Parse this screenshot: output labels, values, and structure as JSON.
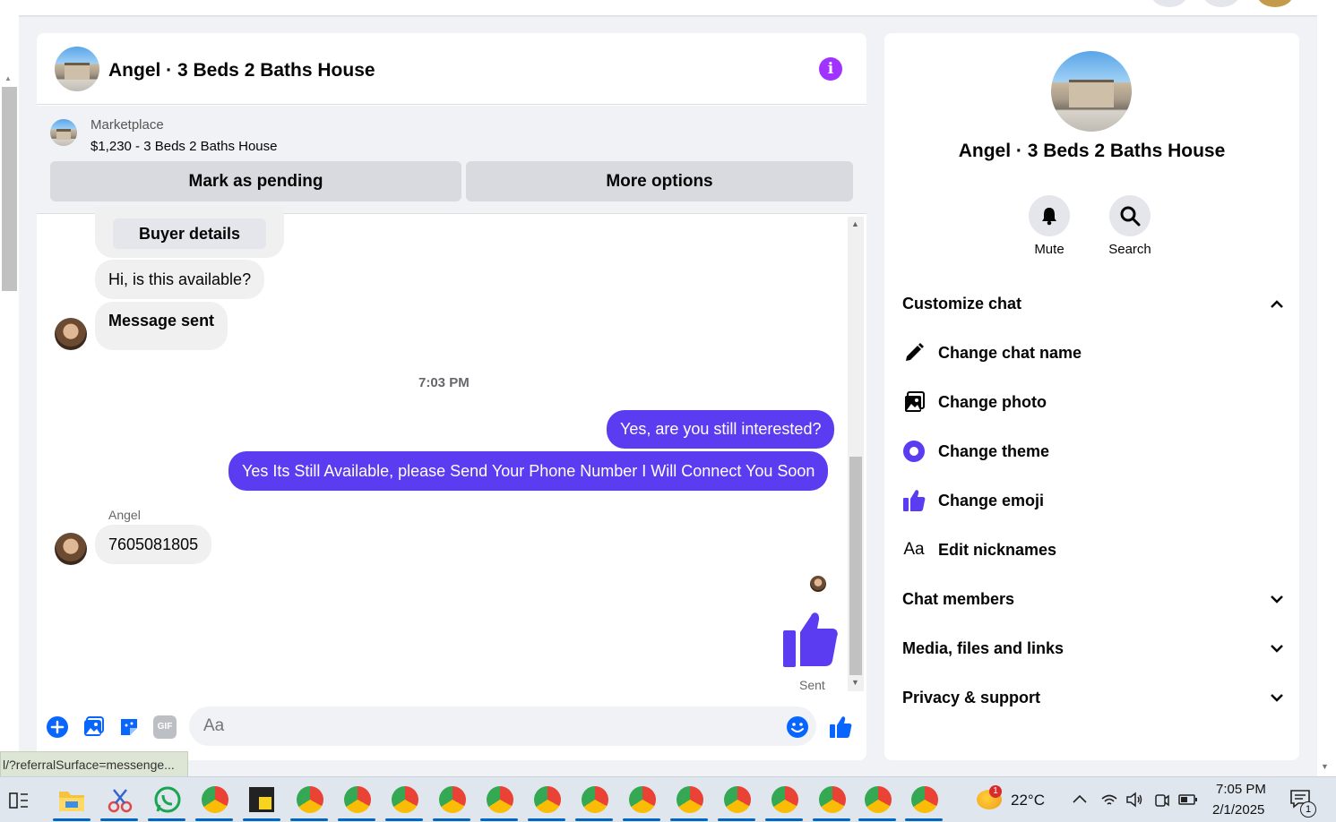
{
  "chat": {
    "title": "Angel · 3 Beds 2 Baths House",
    "marketplace_label": "Marketplace",
    "listing": "$1,230 - 3 Beds 2 Baths House",
    "mark_pending_label": "Mark as pending",
    "more_options_label": "More options"
  },
  "messages": {
    "buyer_details_label": "Buyer details",
    "incoming_1": "Hi, is this available?",
    "incoming_2": "Message sent",
    "timestamp": "7:03 PM",
    "outgoing_1": "Yes, are you still interested?",
    "outgoing_2": "Yes Its Still Available, please Send Your Phone Number I Will Connect You Soon",
    "sender_name": "Angel",
    "incoming_3": "7605081805",
    "sent_status": "Sent"
  },
  "composer": {
    "placeholder": "Aa"
  },
  "status_url": "l/?referralSurface=messenge...",
  "info_panel": {
    "name": "Angel · 3 Beds 2 Baths House",
    "mute_label": "Mute",
    "search_label": "Search",
    "customize_chat": "Customize chat",
    "options": {
      "change_chat_name": "Change chat name",
      "change_photo": "Change photo",
      "change_theme": "Change theme",
      "change_emoji": "Change emoji",
      "edit_nicknames": "Edit nicknames"
    },
    "chat_members": "Chat members",
    "media_files_links": "Media, files and links",
    "privacy_support": "Privacy & support",
    "nicknames_glyph": "Aa"
  },
  "taskbar": {
    "weather_temp": "22°C",
    "weather_badge": "1",
    "time": "7:05 PM",
    "date": "2/1/2025",
    "notification_count": "1"
  },
  "colors": {
    "accent": "#5b3cf0",
    "messenger_blue": "#0866ff",
    "info_purple": "#a033ff"
  }
}
